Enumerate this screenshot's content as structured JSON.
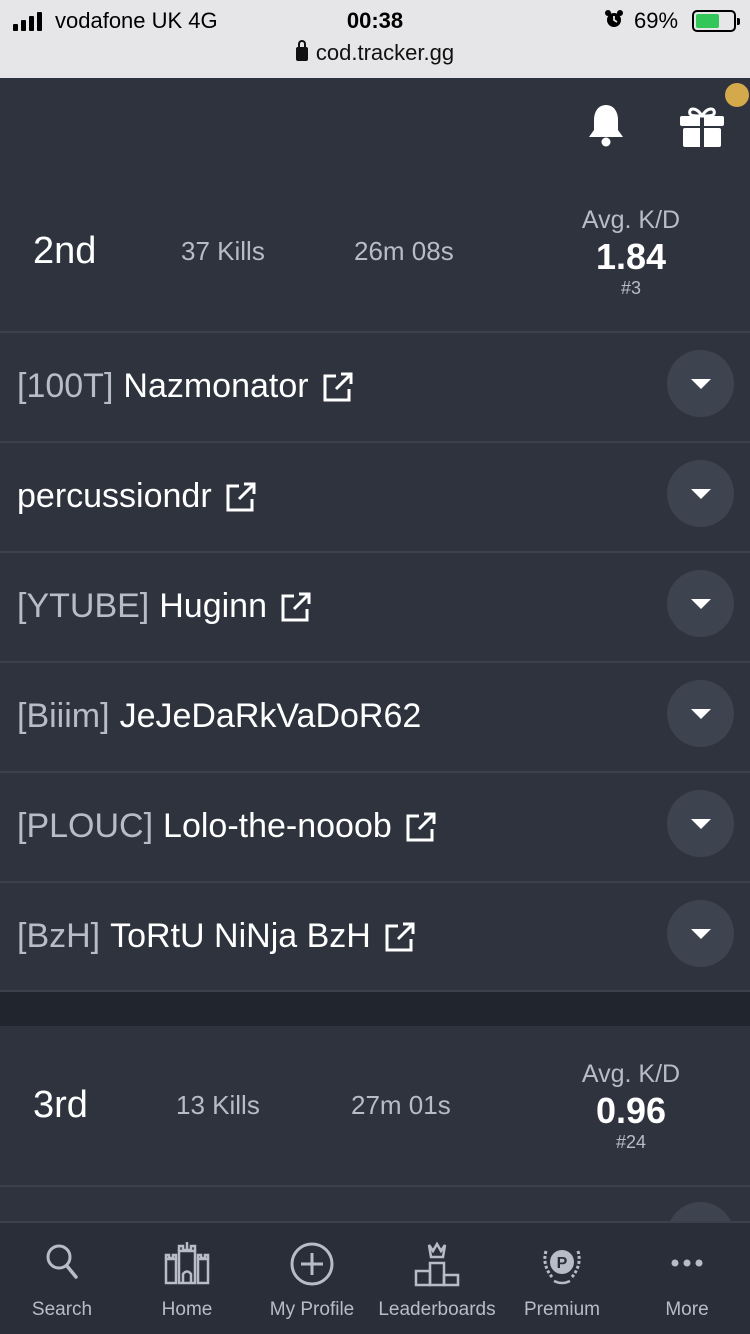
{
  "status_bar": {
    "carrier": "vodafone UK   4G",
    "time": "00:38",
    "battery": "69%",
    "url": "cod.tracker.gg"
  },
  "matches": [
    {
      "place": "2nd",
      "kills": "37 Kills",
      "duration": "26m 08s",
      "kd_label": "Avg. K/D",
      "kd_value": "1.84",
      "kd_rank": "#3",
      "players": [
        {
          "tag": "[100T]",
          "name": "Nazmonator",
          "external_link": true
        },
        {
          "tag": "",
          "name": "percussiondr",
          "external_link": true
        },
        {
          "tag": "[YTUBE]",
          "name": "Huginn",
          "external_link": true
        },
        {
          "tag": "[Biiim]",
          "name": "JeJeDaRkVaDoR62",
          "external_link": false
        },
        {
          "tag": "[PLOUC]",
          "name": "Lolo-the-nooob",
          "external_link": true
        },
        {
          "tag": "[BzH]",
          "name": "ToRtU NiNja BzH",
          "external_link": true
        }
      ]
    },
    {
      "place": "3rd",
      "kills": "13 Kills",
      "duration": "27m 01s",
      "kd_label": "Avg. K/D",
      "kd_value": "0.96",
      "kd_rank": "#24"
    }
  ],
  "bottom_nav": {
    "items": [
      {
        "label": "Search",
        "icon": "search-icon"
      },
      {
        "label": "Home",
        "icon": "castle-icon"
      },
      {
        "label": "My Profile",
        "icon": "plus-circle-icon"
      },
      {
        "label": "Leaderboards",
        "icon": "podium-icon"
      },
      {
        "label": "Premium",
        "icon": "premium-badge-icon"
      },
      {
        "label": "More",
        "icon": "more-dots-icon"
      }
    ]
  },
  "colors": {
    "background": "#2e333e",
    "muted_text": "#b7bcc6",
    "notification_dot": "#d3a94b",
    "battery_green": "#33c659"
  }
}
